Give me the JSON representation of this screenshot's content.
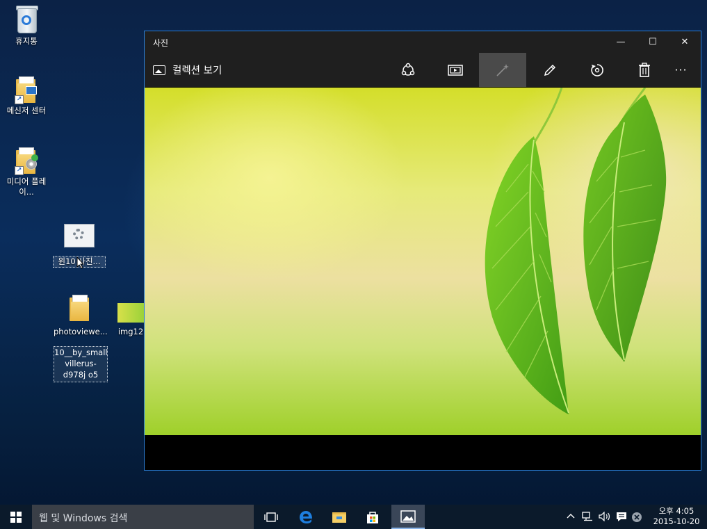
{
  "desktop": {
    "icons": [
      {
        "label": "휴지통"
      },
      {
        "label": "메신저 센터"
      },
      {
        "label": "미디어 플레이..."
      },
      {
        "label": "윈10 사진..."
      },
      {
        "label": "photoviewe..."
      },
      {
        "label": "img12"
      },
      {
        "label": "10__by_small villerus-d978j o5"
      }
    ]
  },
  "window": {
    "title": "사진",
    "controls": {
      "minimize": "—",
      "maximize": "☐",
      "close": "✕"
    },
    "toolbar": {
      "collection_label": "컬렉션 보기",
      "buttons": [
        "share-icon",
        "slideshow-icon",
        "enhance-icon",
        "edit-icon",
        "rotate-icon",
        "delete-icon",
        "more-icon"
      ],
      "more": "···"
    }
  },
  "taskbar": {
    "search_placeholder": "웹 및 Windows 검색",
    "pinned": [
      "task-view-icon",
      "edge-icon",
      "file-explorer-icon",
      "store-icon",
      "photos-icon"
    ],
    "tray": {
      "up_arrow": "^"
    },
    "clock": {
      "time": "오후 4:05",
      "date": "2015-10-20"
    }
  }
}
